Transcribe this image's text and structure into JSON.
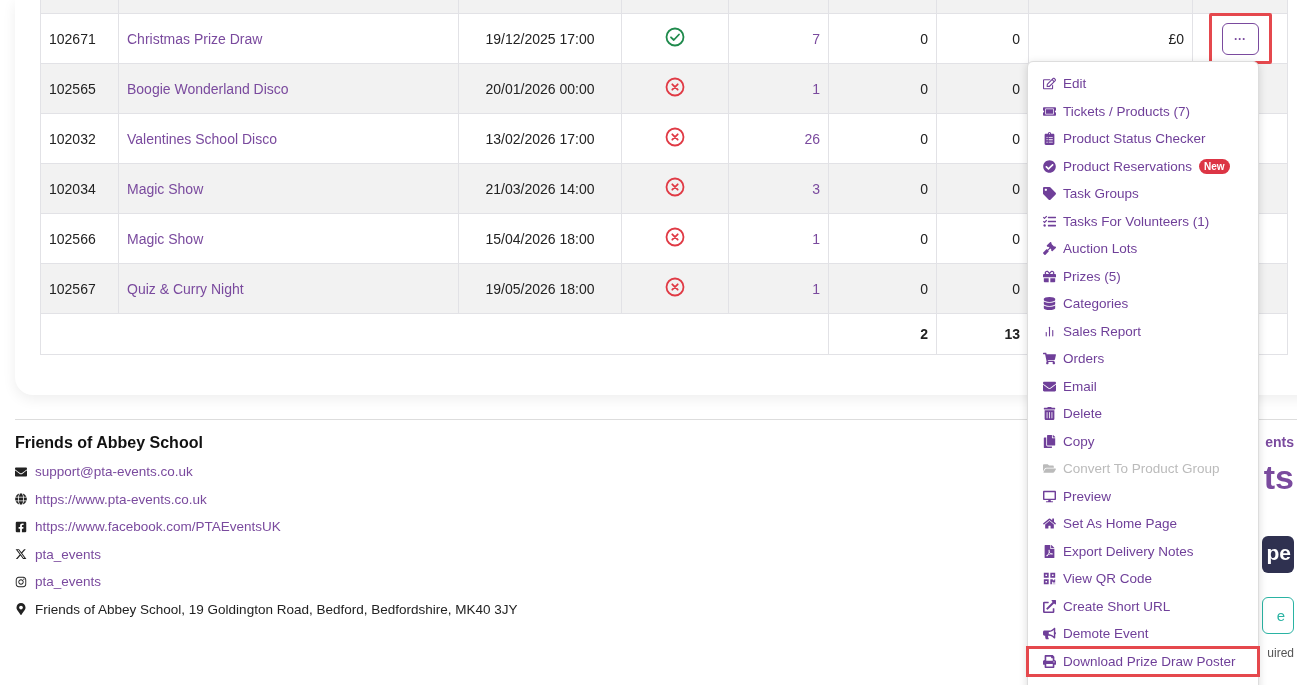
{
  "table": {
    "rows": [
      {
        "id": "102671",
        "name": "Christmas Prize Draw",
        "date": "19/12/2025 17:00",
        "active": true,
        "count": "7",
        "column_6": "0",
        "column_7": "0",
        "amount": "£0",
        "action_label": "···",
        "annotated": true
      },
      {
        "id": "102565",
        "name": "Boogie Wonderland Disco",
        "date": "20/01/2026 00:00",
        "active": false,
        "count": "1",
        "column_6": "0",
        "column_7": "0"
      },
      {
        "id": "102032",
        "name": "Valentines School Disco",
        "date": "13/02/2026 17:00",
        "active": false,
        "count": "26",
        "column_6": "0",
        "column_7": "0"
      },
      {
        "id": "102034",
        "name": "Magic Show",
        "date": "21/03/2026 14:00",
        "active": false,
        "count": "3",
        "column_6": "0",
        "column_7": "0"
      },
      {
        "id": "102566",
        "name": "Magic Show",
        "date": "15/04/2026 18:00",
        "active": false,
        "count": "1",
        "column_6": "0",
        "column_7": "0"
      },
      {
        "id": "102567",
        "name": "Quiz & Curry Night",
        "date": "19/05/2026 18:00",
        "active": false,
        "count": "1",
        "column_6": "0",
        "column_7": "0"
      }
    ],
    "totals": {
      "column_6": "2",
      "column_7": "13"
    }
  },
  "menu": {
    "items": [
      {
        "label": "Edit",
        "disabled": false,
        "annotated": false
      },
      {
        "label": "Tickets / Products (7)",
        "disabled": false,
        "annotated": false
      },
      {
        "label": "Product Status Checker",
        "disabled": false,
        "annotated": false
      },
      {
        "label": "Product Reservations",
        "badge": "New",
        "disabled": false,
        "annotated": false
      },
      {
        "label": "Task Groups",
        "disabled": false,
        "annotated": false
      },
      {
        "label": "Tasks For Volunteers (1)",
        "disabled": false,
        "annotated": false
      },
      {
        "label": "Auction Lots",
        "disabled": false,
        "annotated": false
      },
      {
        "label": "Prizes (5)",
        "disabled": false,
        "annotated": false
      },
      {
        "label": "Categories",
        "disabled": false,
        "annotated": false
      },
      {
        "label": "Sales Report",
        "disabled": false,
        "annotated": false
      },
      {
        "label": "Orders",
        "disabled": false,
        "annotated": false
      },
      {
        "label": "Email",
        "disabled": false,
        "annotated": false
      },
      {
        "label": "Delete",
        "disabled": false,
        "annotated": false
      },
      {
        "label": "Copy",
        "disabled": false,
        "annotated": false
      },
      {
        "label": "Convert To Product Group",
        "disabled": true,
        "annotated": false
      },
      {
        "label": "Preview",
        "disabled": false,
        "annotated": false
      },
      {
        "label": "Set As Home Page",
        "disabled": false,
        "annotated": false
      },
      {
        "label": "Export Delivery Notes",
        "disabled": false,
        "annotated": false
      },
      {
        "label": "View QR Code",
        "disabled": false,
        "annotated": false
      },
      {
        "label": "Create Short URL",
        "disabled": false,
        "annotated": false
      },
      {
        "label": "Demote Event",
        "disabled": false,
        "annotated": false
      },
      {
        "label": "Download Prize Draw Poster",
        "disabled": false,
        "annotated": true
      }
    ]
  },
  "footer": {
    "title": "Friends of Abbey School",
    "contacts": [
      {
        "kind": "link",
        "text": "support@pta-events.co.uk"
      },
      {
        "kind": "link",
        "text": "https://www.pta-events.co.uk"
      },
      {
        "kind": "link",
        "text": "https://www.facebook.com/PTAEventsUK"
      },
      {
        "kind": "link",
        "text": "pta_events"
      },
      {
        "kind": "link",
        "text": "pta_events"
      },
      {
        "kind": "text",
        "text": "Friends of Abbey School, 19 Goldington Road, Bedford, Bedfordshire, MK40 3JY"
      }
    ],
    "right": {
      "heading": "ents",
      "logo": "ts",
      "dark_button": "pe",
      "outline_button": "e",
      "note": "uired"
    }
  }
}
